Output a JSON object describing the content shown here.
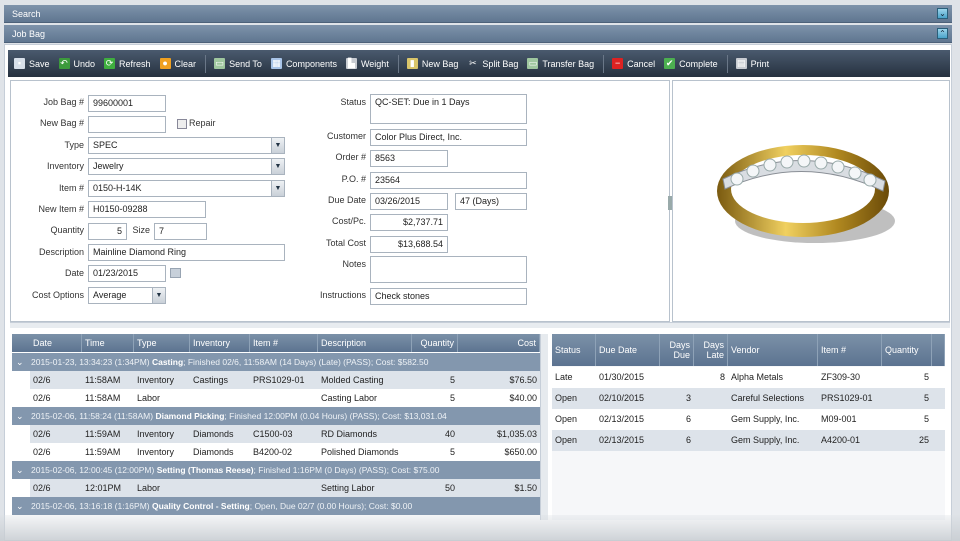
{
  "bars": {
    "search": "Search",
    "jobbag": "Job Bag"
  },
  "toolbar": [
    {
      "label": "Save",
      "icon": "save-icon",
      "color": "#d8e0ea",
      "glyph": "▪"
    },
    {
      "label": "Undo",
      "icon": "undo-icon",
      "color": "#3c9a3c",
      "glyph": "↶"
    },
    {
      "label": "Refresh",
      "icon": "refresh-icon",
      "color": "#3fae3f",
      "glyph": "⟳"
    },
    {
      "label": "Clear",
      "icon": "clear-icon",
      "color": "#f0a020",
      "glyph": "●"
    },
    {
      "label": "Send To",
      "icon": "send-to-icon",
      "color": "#9fc79f",
      "glyph": "▭"
    },
    {
      "label": "Components",
      "icon": "components-icon",
      "color": "#a8c4e8",
      "glyph": "▦"
    },
    {
      "label": "Weight",
      "icon": "weight-icon",
      "color": "#c8ccd2",
      "glyph": "▙"
    },
    {
      "label": "New Bag",
      "icon": "new-bag-icon",
      "color": "#d9c56a",
      "glyph": "▮"
    },
    {
      "label": "Split Bag",
      "icon": "split-bag-icon",
      "color": "transparent",
      "glyph": "✂"
    },
    {
      "label": "Transfer Bag",
      "icon": "transfer-bag-icon",
      "color": "#9fc79f",
      "glyph": "▭"
    },
    {
      "label": "Cancel",
      "icon": "cancel-icon",
      "color": "#d22",
      "glyph": "−"
    },
    {
      "label": "Complete",
      "icon": "complete-icon",
      "color": "#4caf50",
      "glyph": "✔"
    },
    {
      "label": "Print",
      "icon": "print-icon",
      "color": "#c8ccd2",
      "glyph": "▤"
    }
  ],
  "form": {
    "job_bag_label": "Job Bag #",
    "job_bag": "99600001",
    "new_bag_label": "New Bag #",
    "new_bag": "",
    "repair_label": "Repair",
    "repair_checked": false,
    "type_label": "Type",
    "type": "SPEC",
    "inventory_label": "Inventory",
    "inventory": "Jewelry",
    "item_label": "Item #",
    "item": "0150-H-14K",
    "new_item_label": "New Item #",
    "new_item": "H0150-09288",
    "quantity_label": "Quantity",
    "quantity": "5",
    "size_label": "Size",
    "size": "7",
    "description_label": "Description",
    "description": "Mainline Diamond Ring",
    "date_label": "Date",
    "date": "01/23/2015",
    "cost_options_label": "Cost Options",
    "cost_options": "Average",
    "status_label": "Status",
    "status": "QC-SET:   Due in 1 Days",
    "customer_label": "Customer",
    "customer": "Color Plus Direct, Inc.",
    "order_label": "Order #",
    "order": "8563",
    "po_label": "P.O. #",
    "po": "23564",
    "due_date_label": "Due Date",
    "due_date": "03/26/2015",
    "due_days": "47 (Days)",
    "cost_pc_label": "Cost/Pc.",
    "cost_pc": "$2,737.71",
    "total_cost_label": "Total Cost",
    "total_cost": "$13,688.54",
    "notes_label": "Notes",
    "notes": "",
    "instructions_label": "Instructions",
    "instructions": "Check stones"
  },
  "steps_grid": {
    "columns": [
      "Date",
      "Time",
      "Type",
      "Inventory",
      "Item #",
      "Description",
      "Quantity",
      "Cost"
    ],
    "groups": [
      {
        "pre": "2015-01-23, 13:34:23 (1:34PM) ",
        "name": "Casting",
        "post": "; Finished 02/6, 11:58AM (14 Days) (Late) (PASS); Cost: $582.50",
        "rows": [
          [
            "02/6",
            "11:58AM",
            "Inventory",
            "Castings",
            "PRS1029-01",
            "Molded Casting",
            "5",
            "$76.50"
          ],
          [
            "02/6",
            "11:58AM",
            "Labor",
            "",
            "",
            "Casting Labor",
            "5",
            "$40.00"
          ]
        ]
      },
      {
        "pre": "2015-02-06, 11:58:24 (11:58AM) ",
        "name": "Diamond Picking",
        "post": "; Finished 12:00PM (0.04 Hours) (PASS); Cost: $13,031.04",
        "rows": [
          [
            "02/6",
            "11:59AM",
            "Inventory",
            "Diamonds",
            "C1500-03",
            "RD Diamonds",
            "40",
            "$1,035.03"
          ],
          [
            "02/6",
            "11:59AM",
            "Inventory",
            "Diamonds",
            "B4200-02",
            "Polished Diamonds",
            "5",
            "$650.00"
          ]
        ]
      },
      {
        "pre": "2015-02-06, 12:00:45 (12:00PM) ",
        "name": "Setting (Thomas Reese)",
        "post": "; Finished 1:16PM (0 Days) (PASS); Cost: $75.00",
        "rows": [
          [
            "02/6",
            "12:01PM",
            "Labor",
            "",
            "",
            "Setting Labor",
            "50",
            "$1.50"
          ]
        ]
      },
      {
        "pre": "2015-02-06, 13:16:18 (1:16PM) ",
        "name": "Quality Control - Setting",
        "post": "; Open, Due 02/7 (0.00 Hours); Cost: $0.00",
        "rows": []
      }
    ]
  },
  "vendor_grid": {
    "columns": [
      "Status",
      "Due Date",
      "Days Due",
      "Days Late",
      "Vendor",
      "Item #",
      "Quantity"
    ],
    "rows": [
      [
        "Late",
        "01/30/2015",
        "",
        "8",
        "Alpha Metals",
        "ZF309-30",
        "5"
      ],
      [
        "Open",
        "02/10/2015",
        "3",
        "",
        "Careful Selections",
        "PRS1029-01",
        "5"
      ],
      [
        "Open",
        "02/13/2015",
        "6",
        "",
        "Gem Supply, Inc.",
        "M09-001",
        "5"
      ],
      [
        "Open",
        "02/13/2015",
        "6",
        "",
        "Gem Supply, Inc.",
        "A4200-01",
        "25"
      ]
    ]
  }
}
